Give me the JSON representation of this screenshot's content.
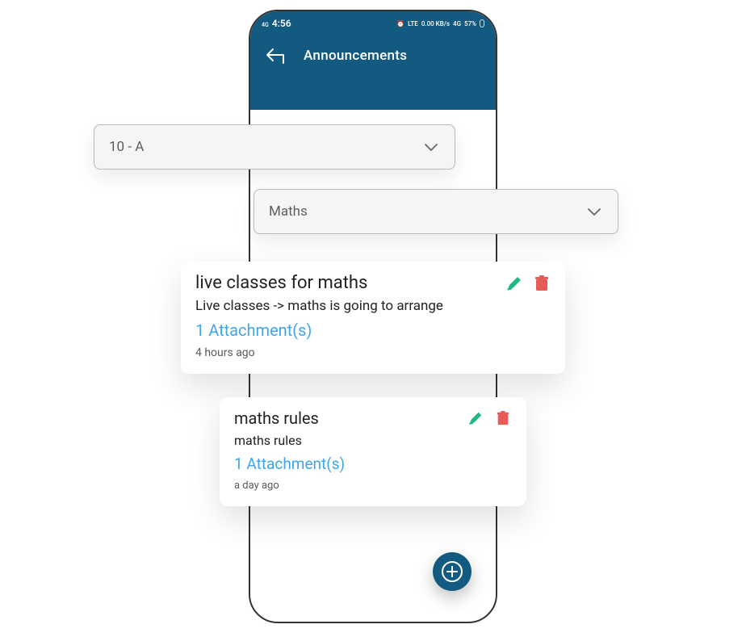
{
  "status": {
    "signal_label": "4G",
    "time": "4:56",
    "alarm": "⏰",
    "lte": "LTE",
    "speed": "0.00 KB/s",
    "net": "4G",
    "battery_pct": "57%"
  },
  "header": {
    "title": "Announcements"
  },
  "dropdowns": {
    "section": "10 - A",
    "subject": "Maths"
  },
  "announcements": [
    {
      "title": "live classes for maths",
      "description": "Live classes -> maths is going to arrange",
      "attachments_label": "1 Attachment(s)",
      "time_ago": "4 hours ago"
    },
    {
      "title": "maths rules",
      "description": "maths rules",
      "attachments_label": "1 Attachment(s)",
      "time_ago": "a day ago"
    }
  ],
  "icons": {
    "back": "back-icon",
    "chevron": "chevron-down-icon",
    "edit": "pencil-icon",
    "delete": "trash-icon",
    "add": "plus-circle-icon"
  }
}
